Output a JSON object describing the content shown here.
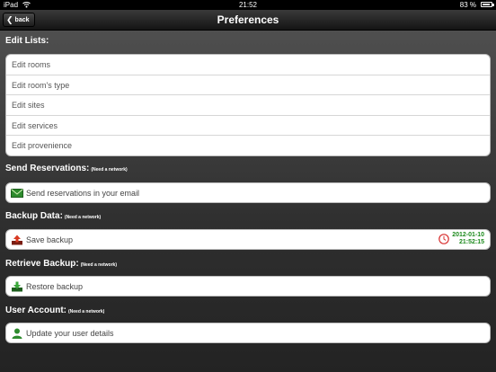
{
  "status_bar": {
    "carrier": "iPad",
    "time": "21:52",
    "battery": "83 %"
  },
  "nav": {
    "title": "Preferences",
    "back_label": "back"
  },
  "edit_lists": {
    "header": "Edit Lists:",
    "items": [
      {
        "label": "Edit rooms"
      },
      {
        "label": "Edit room's type"
      },
      {
        "label": "Edit sites"
      },
      {
        "label": "Edit services"
      },
      {
        "label": "Edit provenience"
      }
    ]
  },
  "send_reservations": {
    "header": "Send Reservations:",
    "note": "(Need a network)",
    "item_label": "Send reservations in your email",
    "icon": "envelope-icon"
  },
  "backup_data": {
    "header": "Backup Data:",
    "note": "(Need a network)",
    "item_label": "Save backup",
    "icon": "upload-icon",
    "last_backup_date": "2012-01-10",
    "last_backup_time": "21:52:15"
  },
  "retrieve_backup": {
    "header": "Retrieve Backup:",
    "note": "(Need a network)",
    "item_label": "Restore backup",
    "icon": "download-icon"
  },
  "user_account": {
    "header": "User Account:",
    "note": "(Need a network)",
    "item_label": "Update your user details",
    "icon": "user-icon"
  },
  "colors": {
    "accent_green": "#1c8a1c",
    "clock_red": "#d83030",
    "header_text": "#ffffff"
  }
}
